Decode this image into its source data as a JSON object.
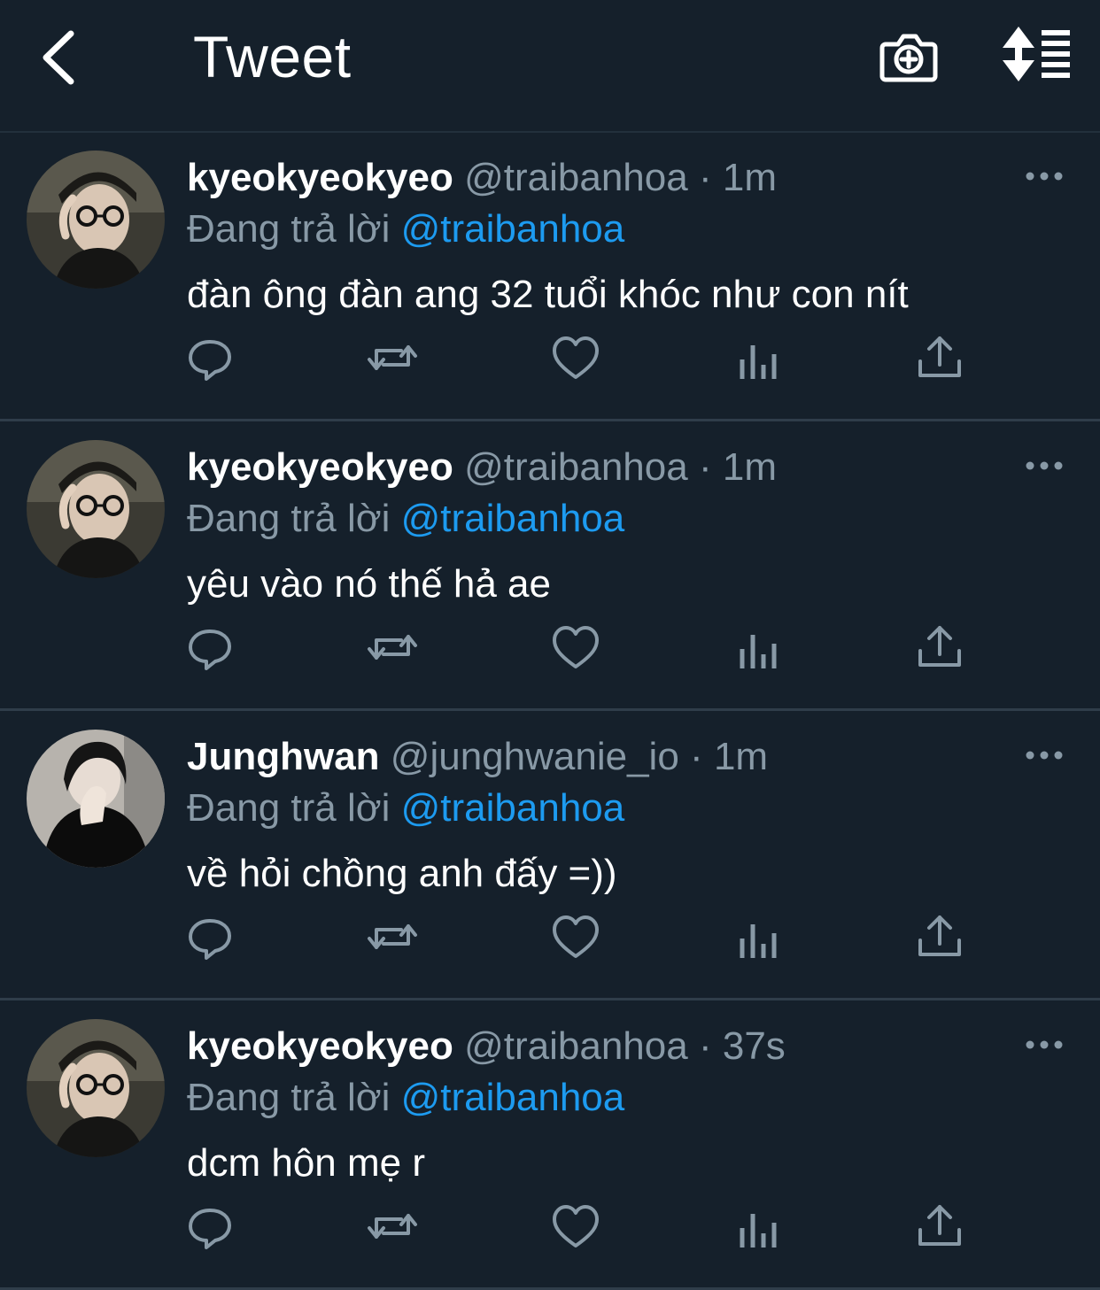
{
  "header": {
    "title": "Tweet",
    "icons": [
      "back-icon",
      "camera-add-icon",
      "sort-icon"
    ]
  },
  "colors": {
    "background": "#15202b",
    "secondary_text": "#8899a6",
    "mention": "#1d9bf0",
    "divider": "#2f3d4a"
  },
  "tweets": [
    {
      "name": "kyeokyeokyeo",
      "handle": "@traibanhoa",
      "separator": "·",
      "time": "1m",
      "reply_prefix": "Đang trả lời",
      "reply_to": "@traibanhoa",
      "text": "đàn ông đàn ang 32 tuổi khóc như con nít",
      "avatar": "avatar-glasses"
    },
    {
      "name": "kyeokyeokyeo",
      "handle": "@traibanhoa",
      "separator": "·",
      "time": "1m",
      "reply_prefix": "Đang trả lời",
      "reply_to": "@traibanhoa",
      "text": "yêu vào nó thế hả ae",
      "avatar": "avatar-glasses"
    },
    {
      "name": "Junghwan",
      "handle": "@junghwanie_io",
      "separator": "·",
      "time": "1m",
      "reply_prefix": "Đang trả lời",
      "reply_to": "@traibanhoa",
      "text": "về hỏi chồng anh đấy =))",
      "avatar": "avatar-dark"
    },
    {
      "name": "kyeokyeokyeo",
      "handle": "@traibanhoa",
      "separator": "·",
      "time": "37s",
      "reply_prefix": "Đang trả lời",
      "reply_to": "@traibanhoa",
      "text": "dcm hôn mẹ r",
      "avatar": "avatar-glasses"
    }
  ],
  "action_icons": [
    "reply-icon",
    "retweet-icon",
    "like-icon",
    "analytics-icon",
    "share-icon"
  ]
}
